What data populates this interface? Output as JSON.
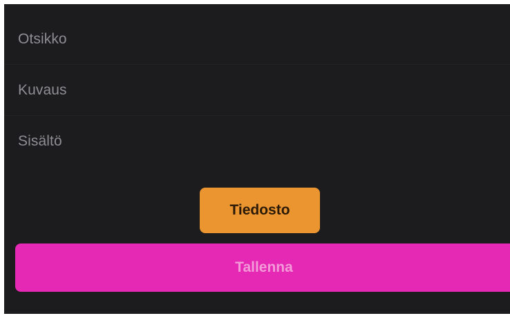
{
  "form": {
    "fields": [
      {
        "placeholder": "Otsikko"
      },
      {
        "placeholder": "Kuvaus"
      },
      {
        "placeholder": "Sisältö"
      }
    ],
    "file_button_label": "Tiedosto",
    "save_button_label": "Tallenna"
  },
  "colors": {
    "background": "#1c1c1e",
    "placeholder_text": "#8e8e93",
    "file_button": "#eb9530",
    "save_button": "#e629b5",
    "save_button_text": "#f39ad9"
  }
}
